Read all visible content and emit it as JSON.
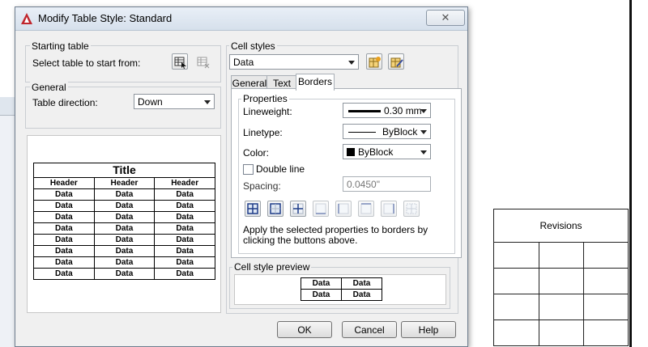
{
  "dialog": {
    "title": "Modify Table Style: Standard",
    "close_symbol": "✕"
  },
  "starting_table": {
    "group_label": "Starting table",
    "prompt": "Select table to start from:",
    "icons": [
      "select-table-icon",
      "remove-table-icon"
    ]
  },
  "general": {
    "group_label": "General",
    "direction_label": "Table direction:",
    "direction_value": "Down"
  },
  "preview_table": {
    "title": "Title",
    "headers": [
      "Header",
      "Header",
      "Header"
    ],
    "rows": [
      [
        "Data",
        "Data",
        "Data"
      ],
      [
        "Data",
        "Data",
        "Data"
      ],
      [
        "Data",
        "Data",
        "Data"
      ],
      [
        "Data",
        "Data",
        "Data"
      ],
      [
        "Data",
        "Data",
        "Data"
      ],
      [
        "Data",
        "Data",
        "Data"
      ],
      [
        "Data",
        "Data",
        "Data"
      ],
      [
        "Data",
        "Data",
        "Data"
      ]
    ]
  },
  "cell_styles": {
    "group_label": "Cell styles",
    "value": "Data",
    "icons": [
      "new-cell-style-icon",
      "manage-cell-styles-icon"
    ]
  },
  "tabs": [
    {
      "label": "General",
      "active": false
    },
    {
      "label": "Text",
      "active": false
    },
    {
      "label": "Borders",
      "active": true
    }
  ],
  "borders": {
    "properties_label": "Properties",
    "lineweight_label": "Lineweight:",
    "lineweight_value": "0.30 mm",
    "linetype_label": "Linetype:",
    "linetype_value": "ByBlock",
    "color_label": "Color:",
    "color_value": "ByBlock",
    "color_swatch": "#000000",
    "double_line_label": "Double line",
    "double_line_checked": false,
    "spacing_label": "Spacing:",
    "spacing_value": "0.0450\"",
    "border_buttons": [
      "all-borders-icon",
      "outside-borders-icon",
      "inside-borders-icon",
      "bottom-border-icon",
      "left-border-icon",
      "top-border-icon",
      "right-border-icon",
      "no-border-icon"
    ],
    "hint": "Apply the selected properties to borders by clicking the buttons above."
  },
  "cell_style_preview": {
    "group_label": "Cell style preview",
    "cells": [
      [
        "Data",
        "Data"
      ],
      [
        "Data",
        "Data"
      ]
    ]
  },
  "buttons": {
    "ok": "OK",
    "cancel": "Cancel",
    "help": "Help"
  },
  "revisions": {
    "title": "Revisions"
  },
  "colors": {
    "accent_red": "#c0262d",
    "dialog_bg": "#f0f0f0"
  }
}
